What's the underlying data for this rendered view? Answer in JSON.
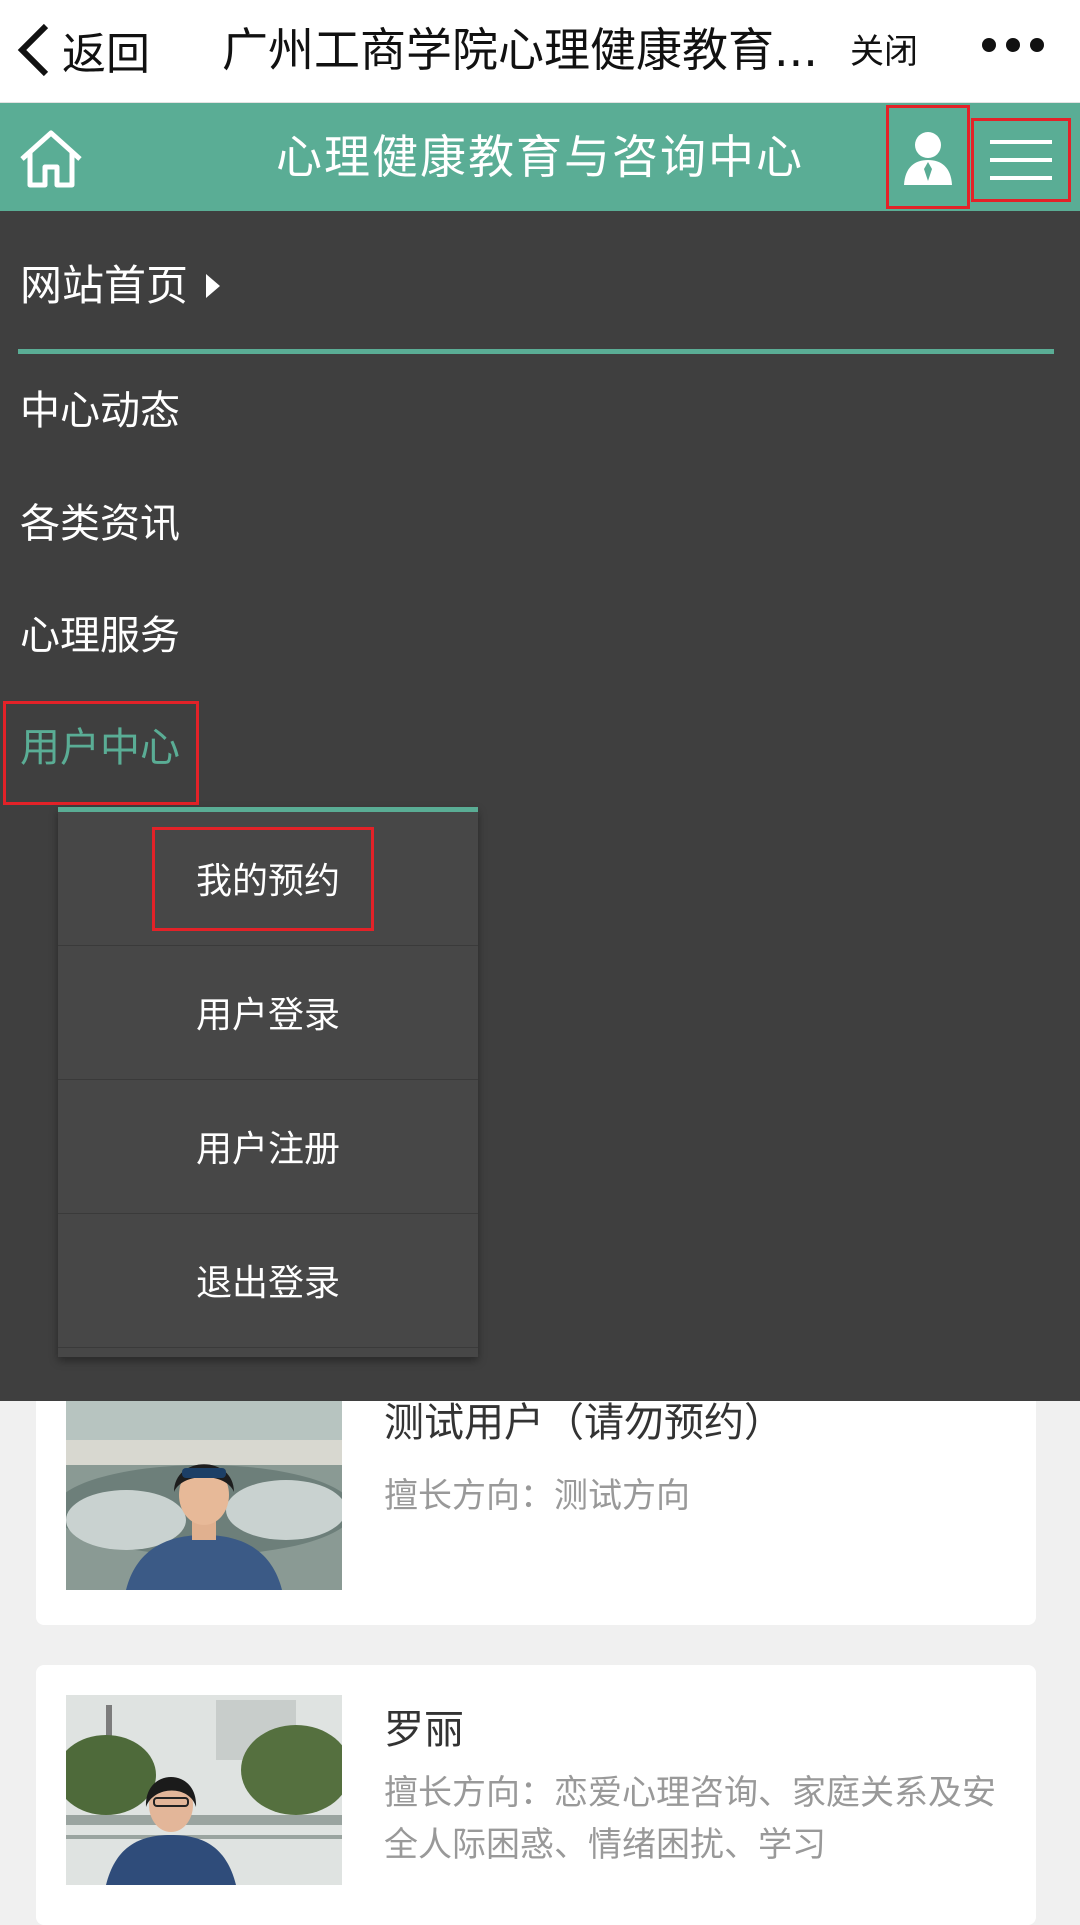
{
  "topbar": {
    "back_label": "返回",
    "title": "广州工商学院心理健康教育...",
    "close_label": "关闭"
  },
  "header": {
    "title": "心理健康教育与咨询中心",
    "accent_color": "#5aad95"
  },
  "nav": {
    "home": "网站首页",
    "items": [
      "中心动态",
      "各类资讯",
      "心理服务",
      "用户中心"
    ],
    "submenu": [
      "我的预约",
      "用户登录",
      "用户注册",
      "退出登录"
    ]
  },
  "counselors": [
    {
      "name": "测试用户（请勿预约）",
      "specialty": "擅长方向：测试方向"
    },
    {
      "name": "罗丽",
      "specialty": "擅长方向：恋爱心理咨询、家庭关系及安全人际困惑、情绪困扰、学习"
    }
  ],
  "highlight_color": "#e32228"
}
